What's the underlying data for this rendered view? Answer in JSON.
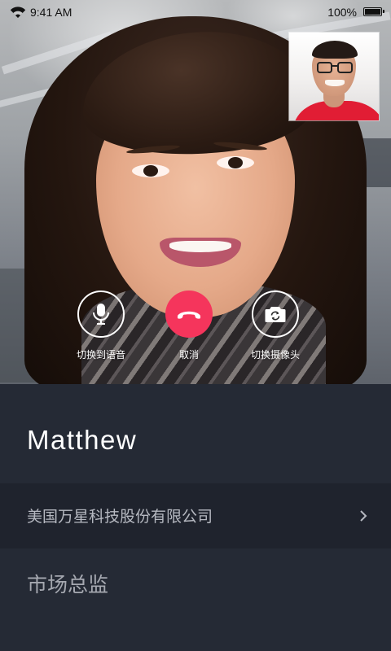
{
  "status_bar": {
    "time": "9:41 AM",
    "battery": "100%"
  },
  "controls": {
    "switch_to_voice": "切换到语音",
    "cancel": "取消",
    "switch_camera": "切换摄像头"
  },
  "contact": {
    "name": "Matthew",
    "company": "美国万星科技股份有限公司",
    "title": "市场总监"
  },
  "colors": {
    "panel_background": "#252a35",
    "company_row_background": "#1f232d",
    "hangup_button": "#f5355c"
  },
  "icons": {
    "wifi": "wifi-icon",
    "battery": "battery-icon",
    "microphone": "microphone-icon",
    "hangup": "phone-hangup-icon",
    "camera_switch": "camera-switch-icon",
    "chevron": "chevron-right-icon"
  }
}
